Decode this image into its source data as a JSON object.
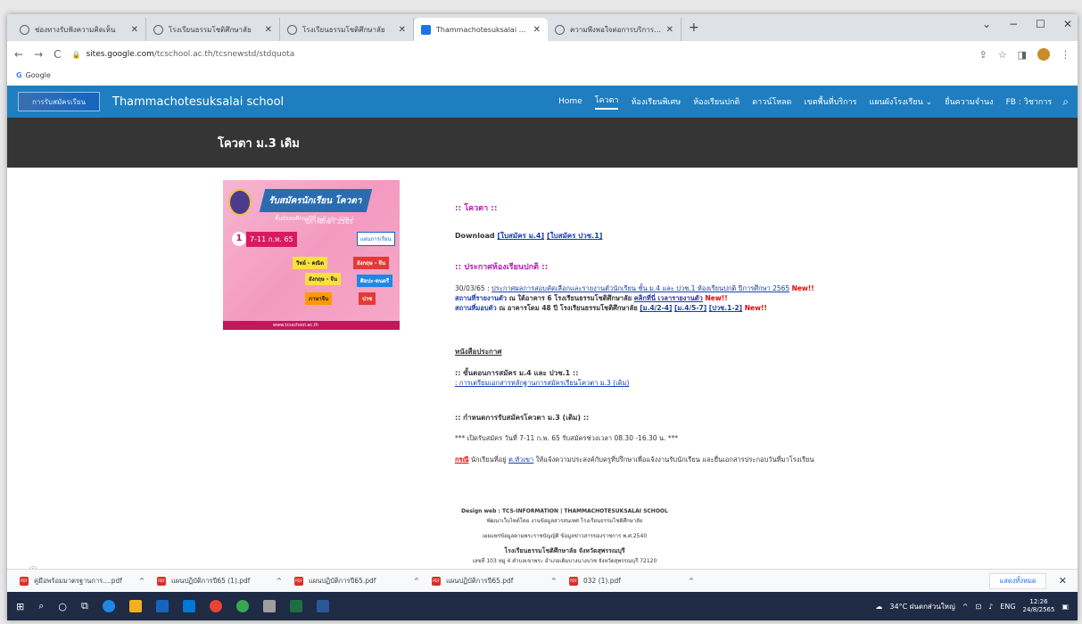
{
  "browser": {
    "tabs": [
      {
        "title": "ช่องทางรับฟังความคิดเห็น",
        "active": false
      },
      {
        "title": "โรงเรียนธรรมโชติศึกษาลัย",
        "active": false
      },
      {
        "title": "โรงเรียนธรรมโชติศึกษาลัย",
        "active": false
      },
      {
        "title": "Thammachotesuksalai school - โ",
        "active": true
      },
      {
        "title": "ความพึงพอใจต่อการบริการจัดการศึก",
        "active": false
      }
    ],
    "new_tab": "+",
    "window_controls": [
      "⌄",
      "−",
      "☐",
      "✕"
    ],
    "url_domain": "sites.google.com",
    "url_path": "/tcschool.ac.th/tcsnewstd/stdquota",
    "bookmark": "Google"
  },
  "site": {
    "logo_text": "การรับสมัครเรียน",
    "name": "Thammachotesuksalai school",
    "nav": [
      "Home",
      "โควตา",
      "ห้องเรียนพิเศษ",
      "ห้องเรียนปกติ",
      "ดาวน์โหลด",
      "เขตพื้นที่บริการ",
      "แผนผังโรงเรียน ⌄",
      "ยื่นความจำนง",
      "FB : วิชาการ"
    ],
    "nav_active": 1,
    "page_title": "โควตา ม.3 เดิม"
  },
  "poster": {
    "title": "รับสมัครนักเรียน โควตา",
    "subtitle": "ชั้นมัธยมศึกษาปีที่ ม.4 และ ปวช.1",
    "year": "ปีการศึกษา 2565",
    "step": "1",
    "date_label": "วันที่",
    "date": "7-11 ก.พ. 65",
    "plan": "แผนการเรียน",
    "chips": [
      "วิทย์ - คณิต",
      "อังกฤษ - จีน",
      "อังกฤษ - จีน",
      "ศิลปะ-ดนตรี",
      "ภาษาจีน",
      "ปวช"
    ],
    "footer": "www.tcsschool.ac.th"
  },
  "content": {
    "quota_head": ":: โควตา ::",
    "download_label": "Download",
    "download_links": [
      "[ใบสมัคร ม.4]",
      "[ใบสมัคร ปวช.1]"
    ],
    "announce_head": ":: ประกาศห้องเรียนปกติ ::",
    "announce_date": "30/03/65 :",
    "announce_link": "ประกาศผลการสอบคัดเลือกและรายงานตัวนักเรียน ชั้น ม.4 และ ปวช.1 ห้องเรียนปกติ ปีการศึกษา 2565",
    "new": "New!!",
    "report_place_label": "สถานที่รายงานตัว",
    "report_place_text": "ณ ใต้อาคาร 6 โรงเรียนธรรมโชติศึกษาลัย",
    "report_place_link": "คลิกที่นี่ เวลารายงานตัว",
    "hand_over_label": "สถานที่มอบตัว",
    "hand_over_text": "ณ อาคารโดม 48 ปี โรงเรียนธรรมโชติศึกษาลัย",
    "hand_over_links": [
      "[ม.4/2-4]",
      "[ม.4/5-7]",
      "[ปวช.1-2]"
    ],
    "notice_head": "หนังสือประกาศ",
    "step_head": ":: ขั้นตอนการสมัคร ม.4 และ ปวช.1 ::",
    "step_link": ": การเตรียมเอกสารหลักฐานการสมัครเรียนโควตา ม.3 (เดิม)",
    "schedule_head": ":: กำหนดการรับสมัครโควตา ม.3 (เดิม) ::",
    "schedule_text": "*** เปิดรับสมัคร วันที่ 7-11 ก.พ. 65 รับสมัครช่วงเวลา 08.30 -16.30 น. ***",
    "case_label": "กรณี",
    "case_text_1": "นักเรียนที่อยู่",
    "case_link": "ต.หัวเขา",
    "case_text_2": "ให้แจ้งความประสงค์กับครูที่ปรึกษาเพื่อแจ้งงานรับนักเรียน และยื่นเอกสารประกอบวันที่มาโรงเรียน"
  },
  "footer": {
    "line1": "Design web : TCS-INFORMATION | THAMMACHOTESUKSALAI SCHOOL",
    "line2": "พัฒนาเว็บไซต์โดย งานข้อมูลสารสนเทศ โรงเรียนธรรมโชติศึกษาลัย",
    "line3": "เผยแพร่ข้อมูลตามพระราชบัญญัติ ข้อมูลข่าวสารของราชการ พ.ศ.2540",
    "line4": "โรงเรียนธรรมโชติศึกษาลัย จังหวัดสุพรรณบุรี",
    "line5": "เลขที่ 103 หมู่ 4 ตำบลเขาพระ อำเภอเดิมบางนางบวช จังหวัดสุพรรณบุรี 72120"
  },
  "downloads": {
    "items": [
      "คู่มือพร้อมมาตรฐานการ....pdf",
      "แผนปฏิบัติการปี65 (1).pdf",
      "แผนปฏิบัติการปี65.pdf",
      "แผนปฏิบัติการปี65.pdf",
      "032 (1).pdf"
    ],
    "show_all": "แสดงทั้งหมด",
    "close": "✕"
  },
  "taskbar": {
    "weather": "34°C ฝนตกส่วนใหญ่",
    "lang": "ENG",
    "time": "12:26",
    "date": "24/8/2565"
  }
}
